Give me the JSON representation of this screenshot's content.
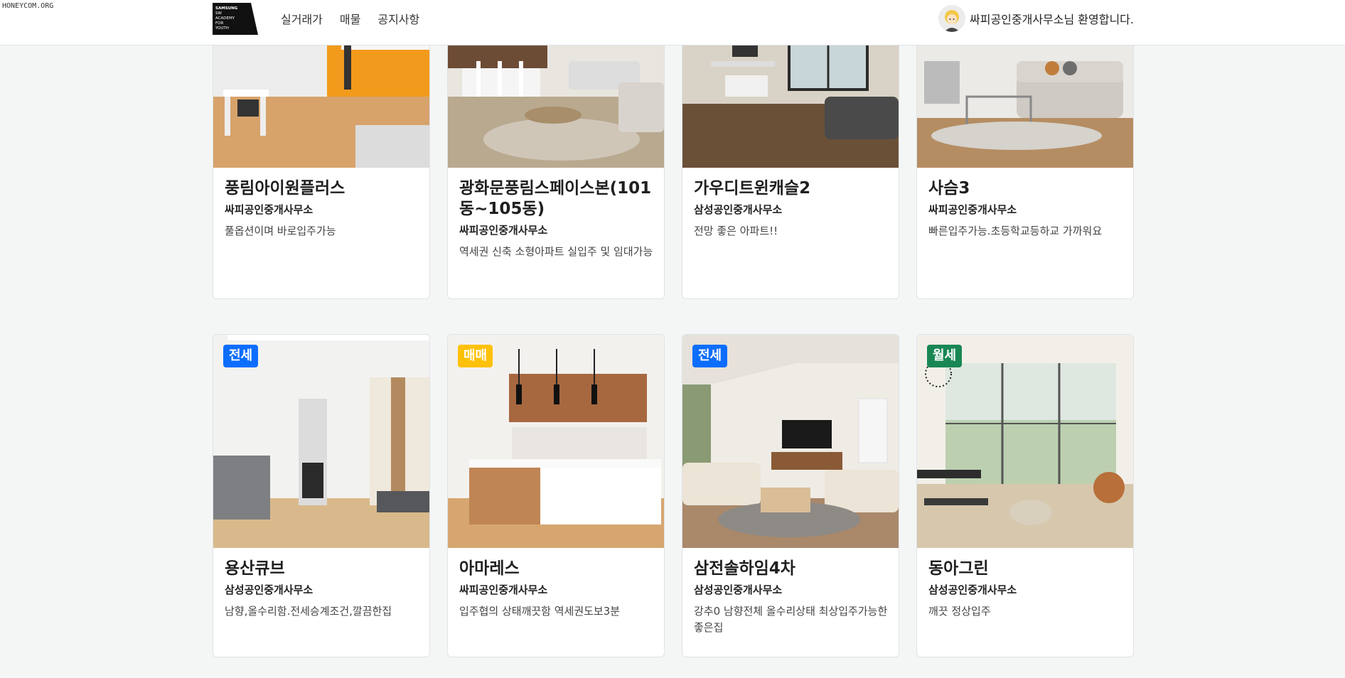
{
  "watermark": "HONEYCOM.ORG",
  "header": {
    "logo_lines": [
      "SAMSUNG",
      "SW",
      "ACADEMY",
      "FOR",
      "YOUTH"
    ],
    "nav": [
      "실거래가",
      "매물",
      "공지사항"
    ],
    "welcome": "싸피공인중개사무소님 환영합니다."
  },
  "listings_row1": [
    {
      "title": "풍림아이원플러스",
      "agency": "싸피공인중개사무소",
      "desc": "풀옵션이며 바로입주가능"
    },
    {
      "title": "광화문풍림스페이스본(101동~105동)",
      "agency": "싸피공인중개사무소",
      "desc": "역세권 신축 소형아파트 실입주 및 임대가능"
    },
    {
      "title": "가우디트윈캐슬2",
      "agency": "삼성공인중개사무소",
      "desc": "전망 좋은 아파트!!"
    },
    {
      "title": "사슴3",
      "agency": "싸피공인중개사무소",
      "desc": "빠른입주가능.초등학교등하교 가까워요"
    }
  ],
  "listings_row2": [
    {
      "badge": "전세",
      "badge_color": "#0d6efd",
      "title": "용산큐브",
      "agency": "삼성공인중개사무소",
      "desc": "남향,올수리함.전세승계조건,깔끔한집"
    },
    {
      "badge": "매매",
      "badge_color": "#ffc107",
      "title": "아마레스",
      "agency": "싸피공인중개사무소",
      "desc": "입주협의 상태깨끗함 역세권도보3분"
    },
    {
      "badge": "전세",
      "badge_color": "#0d6efd",
      "title": "삼전솔하임4차",
      "agency": "삼성공인중개사무소",
      "desc": "강추0 남향전체 올수리상태 최상입주가능한 좋은집"
    },
    {
      "badge": "월세",
      "badge_color": "#198754",
      "title": "동아그린",
      "agency": "삼성공인중개사무소",
      "desc": "깨끗 정상입주"
    }
  ]
}
